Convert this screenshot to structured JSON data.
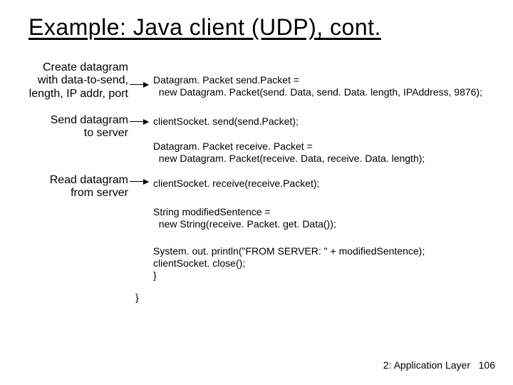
{
  "title": "Example: Java client (UDP), cont.",
  "annotations": {
    "create": "Create datagram\nwith data-to-send,\nlength, IP addr, port",
    "send": "Send datagram\nto server",
    "read": "Read datagram\nfrom server"
  },
  "code": {
    "l1": "Datagram. Packet send.Packet =",
    "l2": "  new Datagram. Packet(send. Data, send. Data. length, IPAddress, 9876);",
    "l3": "clientSocket. send(send.Packet);",
    "l4": "Datagram. Packet receive. Packet =",
    "l5": "  new Datagram. Packet(receive. Data, receive. Data. length);",
    "l6": "clientSocket. receive(receive.Packet);",
    "l7": "String modifiedSentence =",
    "l8": "  new String(receive. Packet. get. Data());",
    "l9": "System. out. println(\"FROM SERVER: \" + modifiedSentence);",
    "l10": "clientSocket. close();",
    "l11": "}",
    "l12": "}"
  },
  "footer": {
    "section": "2: Application Layer",
    "page": "106"
  }
}
